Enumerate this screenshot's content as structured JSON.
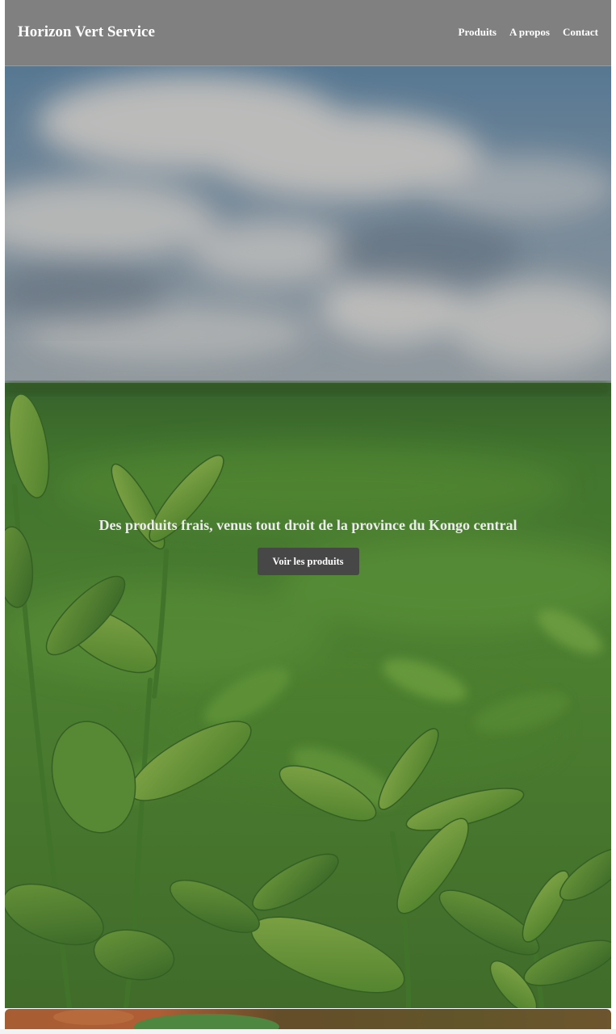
{
  "header": {
    "brand": "Horizon Vert Service",
    "nav": [
      "Produits",
      "A propos",
      "Contact"
    ],
    "background_color": "#808080"
  },
  "hero": {
    "background_image": "tea-plantation-field-under-cloudy-sky",
    "tagline": "Des produits frais, venus tout droit de la province du Kongo central",
    "cta_label": "Voir les produits",
    "cta_color": "#474747"
  },
  "next_section": {
    "image": "orange-and-green-produce-photo"
  }
}
